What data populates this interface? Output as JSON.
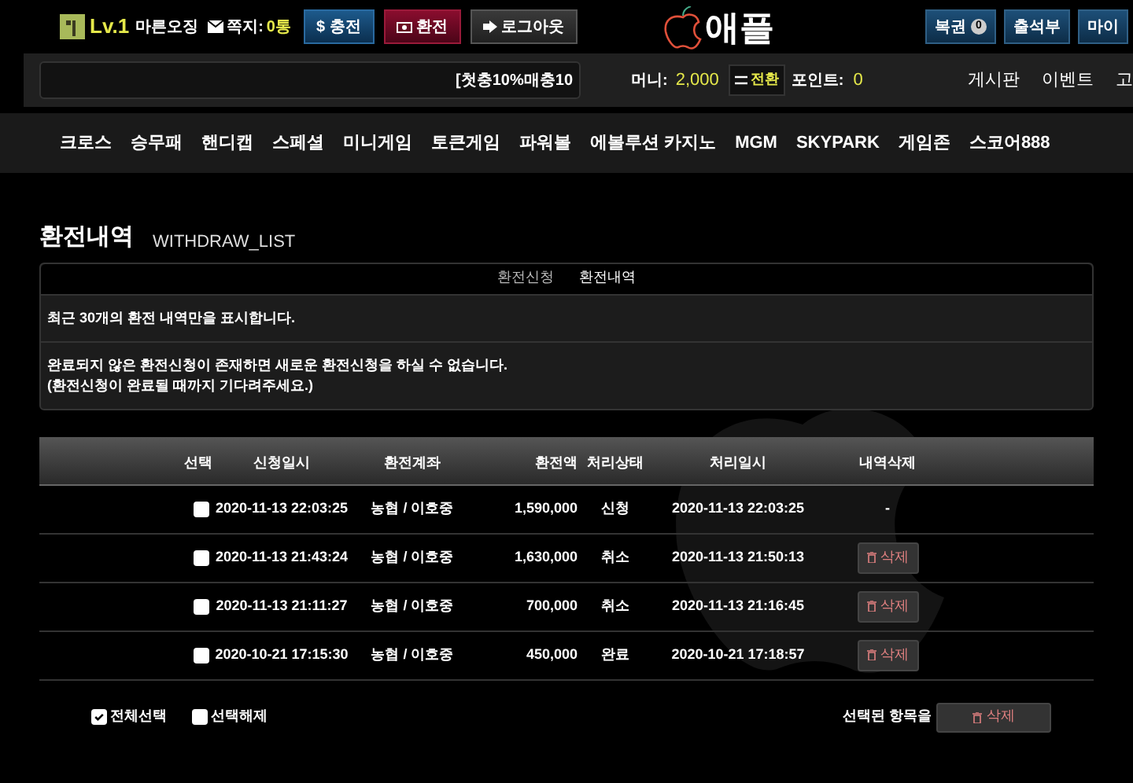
{
  "header": {
    "level": "Lv.1",
    "nickname": "마른오징",
    "memo_label": "쪽지:",
    "memo_count": "0통",
    "buttons": [
      {
        "kind": "charge",
        "icon": "$",
        "label": "충전"
      },
      {
        "kind": "exchange",
        "label": "환전"
      },
      {
        "kind": "logout",
        "label": "로그아웃"
      }
    ],
    "logo": "애플",
    "right_buttons": [
      {
        "label": "복권",
        "badge": "0"
      },
      {
        "label": "출석부"
      },
      {
        "label": "마이"
      }
    ]
  },
  "info_bar": {
    "ticker": "[첫충10%매충10",
    "money_label": "머니:",
    "money": "2,000",
    "convert_button": "전환",
    "point_label": "포인트:",
    "point": "0",
    "links": [
      "게시판",
      "이벤트",
      "고"
    ]
  },
  "nav": [
    "크로스",
    "승무패",
    "핸디캡",
    "스페셜",
    "미니게임",
    "토큰게임",
    "파워볼",
    "에볼루션 카지노",
    "MGM",
    "SKYPARK",
    "게임존",
    "스코어888"
  ],
  "page": {
    "title": "환전내역",
    "subtitle": "WITHDRAW_LIST"
  },
  "tabs": [
    {
      "label": "환전신청",
      "selected": false
    },
    {
      "label": "환전내역",
      "selected": true
    }
  ],
  "notices": [
    {
      "lines": [
        "최근 30개의 환전 내역만을 표시합니다."
      ]
    },
    {
      "lines": [
        "완료되지 않은 환전신청이 존재하면 새로운 환전신청을 하실 수 없습니다.",
        "(환전신청이 완료될 때까지 기다려주세요.)"
      ]
    }
  ],
  "table": {
    "columns": [
      "선택",
      "신청일시",
      "환전계좌",
      "환전액",
      "처리상태",
      "처리일시",
      "내역삭제"
    ],
    "rows": [
      {
        "checked": false,
        "requested": "2020-11-13 22:03:25",
        "account": "농협 / 이호중",
        "amount": "1,590,000",
        "status": "신청",
        "processed": "2020-11-13 22:03:25",
        "delete": "-",
        "kind": "dash"
      },
      {
        "checked": false,
        "requested": "2020-11-13 21:43:24",
        "account": "농협 / 이호중",
        "amount": "1,630,000",
        "status": "취소",
        "processed": "2020-11-13 21:50:13",
        "delete": "삭제",
        "kind": "button"
      },
      {
        "checked": false,
        "requested": "2020-11-13 21:11:27",
        "account": "농협 / 이호중",
        "amount": "700,000",
        "status": "취소",
        "processed": "2020-11-13 21:16:45",
        "delete": "삭제",
        "kind": "button"
      },
      {
        "checked": false,
        "requested": "2020-10-21 17:15:30",
        "account": "농협 / 이호중",
        "amount": "450,000",
        "status": "완료",
        "processed": "2020-10-21 17:18:57",
        "delete": "삭제",
        "kind": "button"
      }
    ]
  },
  "footer": {
    "select_all": {
      "label": "전체선택",
      "checked": true
    },
    "deselect_all": {
      "label": "선택해제",
      "checked": false
    },
    "selected_label": "선택된 항목을",
    "delete_button": "삭제"
  }
}
